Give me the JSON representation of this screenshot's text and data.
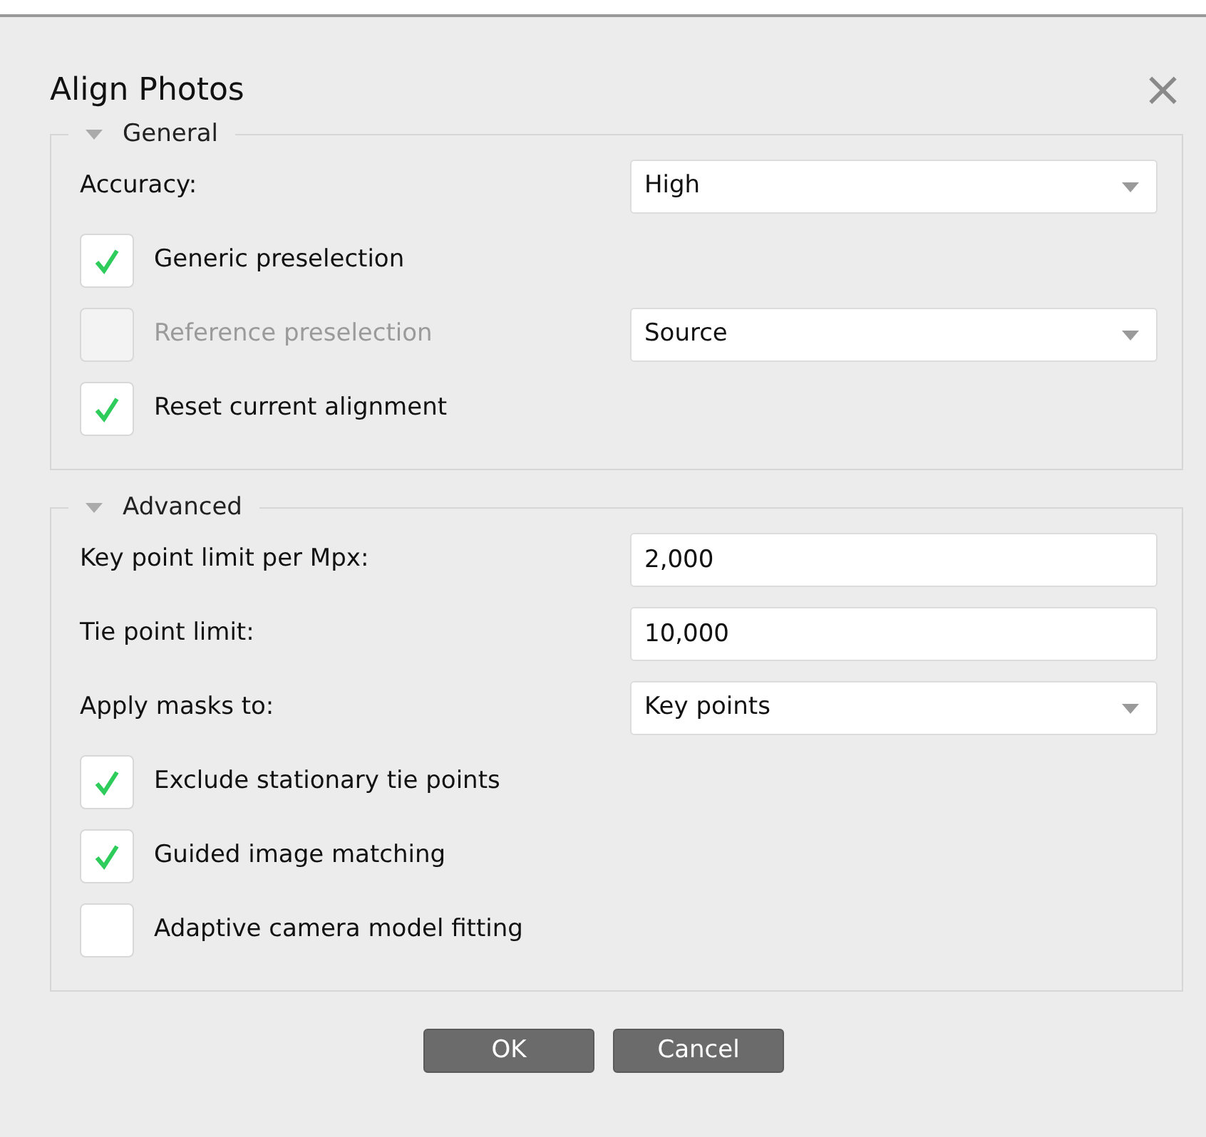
{
  "dialog": {
    "title": "Align Photos",
    "close": "×"
  },
  "sections": [
    {
      "title": "General",
      "expanded": true,
      "items": [
        {
          "kind": "select",
          "label": "Accuracy:",
          "value": "High"
        },
        {
          "kind": "checkbox",
          "label": "Generic preselection",
          "checked": true,
          "disabled": false
        },
        {
          "kind": "checkbox",
          "label": "Reference preselection",
          "checked": false,
          "disabled": true,
          "select": {
            "value": "Source"
          }
        },
        {
          "kind": "checkbox",
          "label": "Reset current alignment",
          "checked": true,
          "disabled": false
        }
      ]
    },
    {
      "title": "Advanced",
      "expanded": true,
      "items": [
        {
          "kind": "input",
          "label": "Key point limit per Mpx:",
          "value": "2,000"
        },
        {
          "kind": "input",
          "label": "Tie point limit:",
          "value": "10,000"
        },
        {
          "kind": "select",
          "label": "Apply masks to:",
          "value": "Key points"
        },
        {
          "kind": "checkbox",
          "label": "Exclude stationary tie points",
          "checked": true,
          "disabled": false
        },
        {
          "kind": "checkbox",
          "label": "Guided image matching",
          "checked": true,
          "disabled": false
        },
        {
          "kind": "checkbox",
          "label": "Adaptive camera model fitting",
          "checked": false,
          "disabled": false
        }
      ]
    }
  ],
  "buttons": [
    "OK",
    "Cancel"
  ]
}
